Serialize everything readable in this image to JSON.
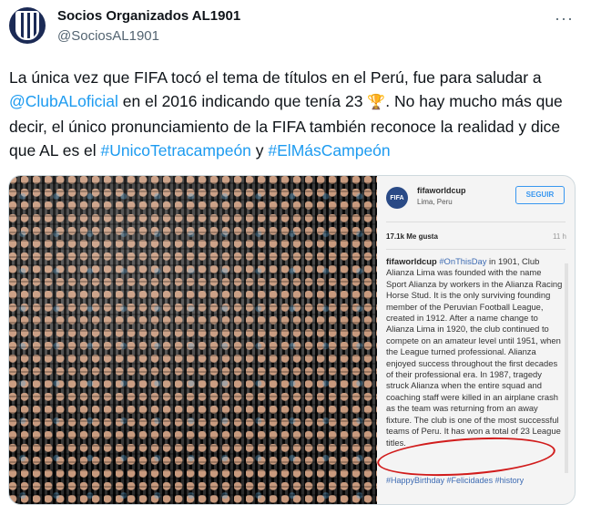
{
  "author": {
    "name": "Socios Organizados AL1901",
    "handle": "@SociosAL1901"
  },
  "more_icon": "···",
  "tweet": {
    "p1": "La única vez que FIFA tocó el tema de títulos en el Perú, fue para saludar a ",
    "mention": "@ClubALoficial",
    "p2": " en el 2016 indicando que tenía 23 ",
    "trophy": "🏆",
    "p3": ". No hay mucho más que decir, el único pronunciamiento de la FIFA también reconoce la realidad y dice que AL es el ",
    "hashtag1": "#UnicoTetracampeón",
    "p4": " y ",
    "hashtag2": "#ElMásCampeón"
  },
  "embed": {
    "logo_text": "FIFA",
    "account": "fifaworldcup",
    "location": "Lima, Peru",
    "follow_label": "SEGUIR",
    "likes": "17.1k Me gusta",
    "time_ago": "11 h",
    "caption_user": "fifaworldcup",
    "caption_hashtag": "#OnThisDay",
    "caption_text": " in 1901, Club Alianza Lima was founded with the name Sport Alianza by workers in the Alianza Racing Horse Stud. It is the only surviving founding member of the Peruvian Football League, created in 1912. After a name change to Alianza Lima in 1920, the club continued to compete on an amateur level until 1951, when the League turned professional. Alianza enjoyed success throughout the first decades of their professional era. In 1987, tragedy struck Alianza when the entire squad and coaching staff were killed in an airplane crash as the team was returning from an away fixture. The club is one of the most successful teams of Peru. It has won a total of 23 League titles.",
    "hashtags": "#HappyBirthday #Felicidades #history"
  },
  "colors": {
    "link": "#1d9bf0",
    "highlight_circle": "#d11c1c"
  }
}
